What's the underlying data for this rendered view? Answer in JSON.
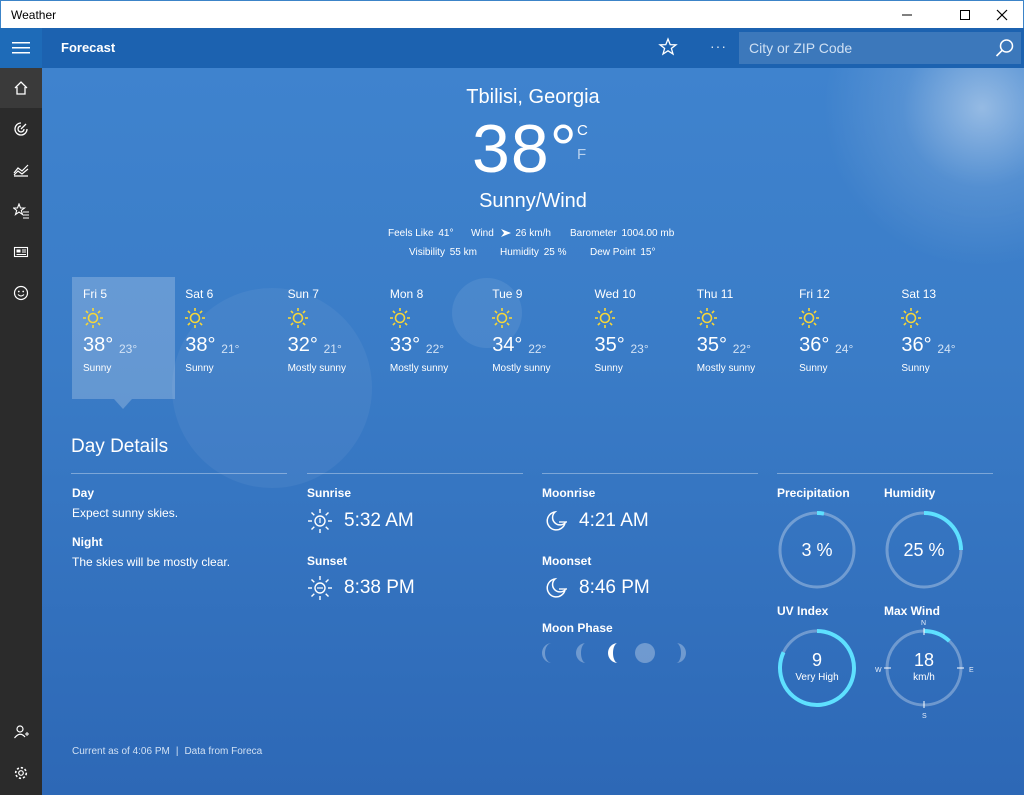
{
  "window": {
    "title": "Weather"
  },
  "header": {
    "title": "Forecast",
    "search_placeholder": "City or ZIP Code",
    "more": "···"
  },
  "current": {
    "location": "Tbilisi, Georgia",
    "temperature": "38",
    "degree": "°",
    "unit_c": "C",
    "unit_f": "F",
    "condition": "Sunny/Wind",
    "feels_like_label": "Feels Like",
    "feels_like": "41°",
    "wind_label": "Wind",
    "wind": "26 km/h",
    "barometer_label": "Barometer",
    "barometer": "1004.00 mb",
    "visibility_label": "Visibility",
    "visibility": "55 km",
    "humidity_label": "Humidity",
    "humidity": "25 %",
    "dewpoint_label": "Dew Point",
    "dewpoint": "15°"
  },
  "forecast": [
    {
      "day": "Fri 5",
      "hi": "38°",
      "lo": "23°",
      "cond": "Sunny"
    },
    {
      "day": "Sat 6",
      "hi": "38°",
      "lo": "21°",
      "cond": "Sunny"
    },
    {
      "day": "Sun 7",
      "hi": "32°",
      "lo": "21°",
      "cond": "Mostly sunny"
    },
    {
      "day": "Mon 8",
      "hi": "33°",
      "lo": "22°",
      "cond": "Mostly sunny"
    },
    {
      "day": "Tue 9",
      "hi": "34°",
      "lo": "22°",
      "cond": "Mostly sunny"
    },
    {
      "day": "Wed 10",
      "hi": "35°",
      "lo": "23°",
      "cond": "Sunny"
    },
    {
      "day": "Thu 11",
      "hi": "35°",
      "lo": "22°",
      "cond": "Mostly sunny"
    },
    {
      "day": "Fri 12",
      "hi": "36°",
      "lo": "24°",
      "cond": "Sunny"
    },
    {
      "day": "Sat 13",
      "hi": "36°",
      "lo": "24°",
      "cond": "Sunny"
    }
  ],
  "details": {
    "title": "Day Details",
    "day_label": "Day",
    "day_text": "Expect sunny skies.",
    "night_label": "Night",
    "night_text": "The skies will be mostly clear.",
    "sunrise_label": "Sunrise",
    "sunrise": "5:32 AM",
    "sunset_label": "Sunset",
    "sunset": "8:38 PM",
    "moonrise_label": "Moonrise",
    "moonrise": "4:21 AM",
    "moonset_label": "Moonset",
    "moonset": "8:46 PM",
    "moonphase_label": "Moon Phase",
    "precip_label": "Precipitation",
    "precip": "3 %",
    "precip_fraction": 0.03,
    "humidity_label": "Humidity",
    "humidity": "25 %",
    "humidity_fraction": 0.25,
    "uv_label": "UV Index",
    "uv": "9",
    "uv_desc": "Very High",
    "uv_fraction": 0.82,
    "wind_label": "Max Wind",
    "wind": "18",
    "wind_unit": "km/h",
    "wind_fraction": 0.12,
    "compass": {
      "n": "N",
      "e": "E",
      "s": "S",
      "w": "W"
    }
  },
  "footer": {
    "current": "Current as of 4:06 PM",
    "sep": "|",
    "source": "Data from Foreca"
  },
  "colors": {
    "accent": "#1c62b0",
    "ring_active": "#5ee0ff",
    "sun": "#f5d63a"
  }
}
